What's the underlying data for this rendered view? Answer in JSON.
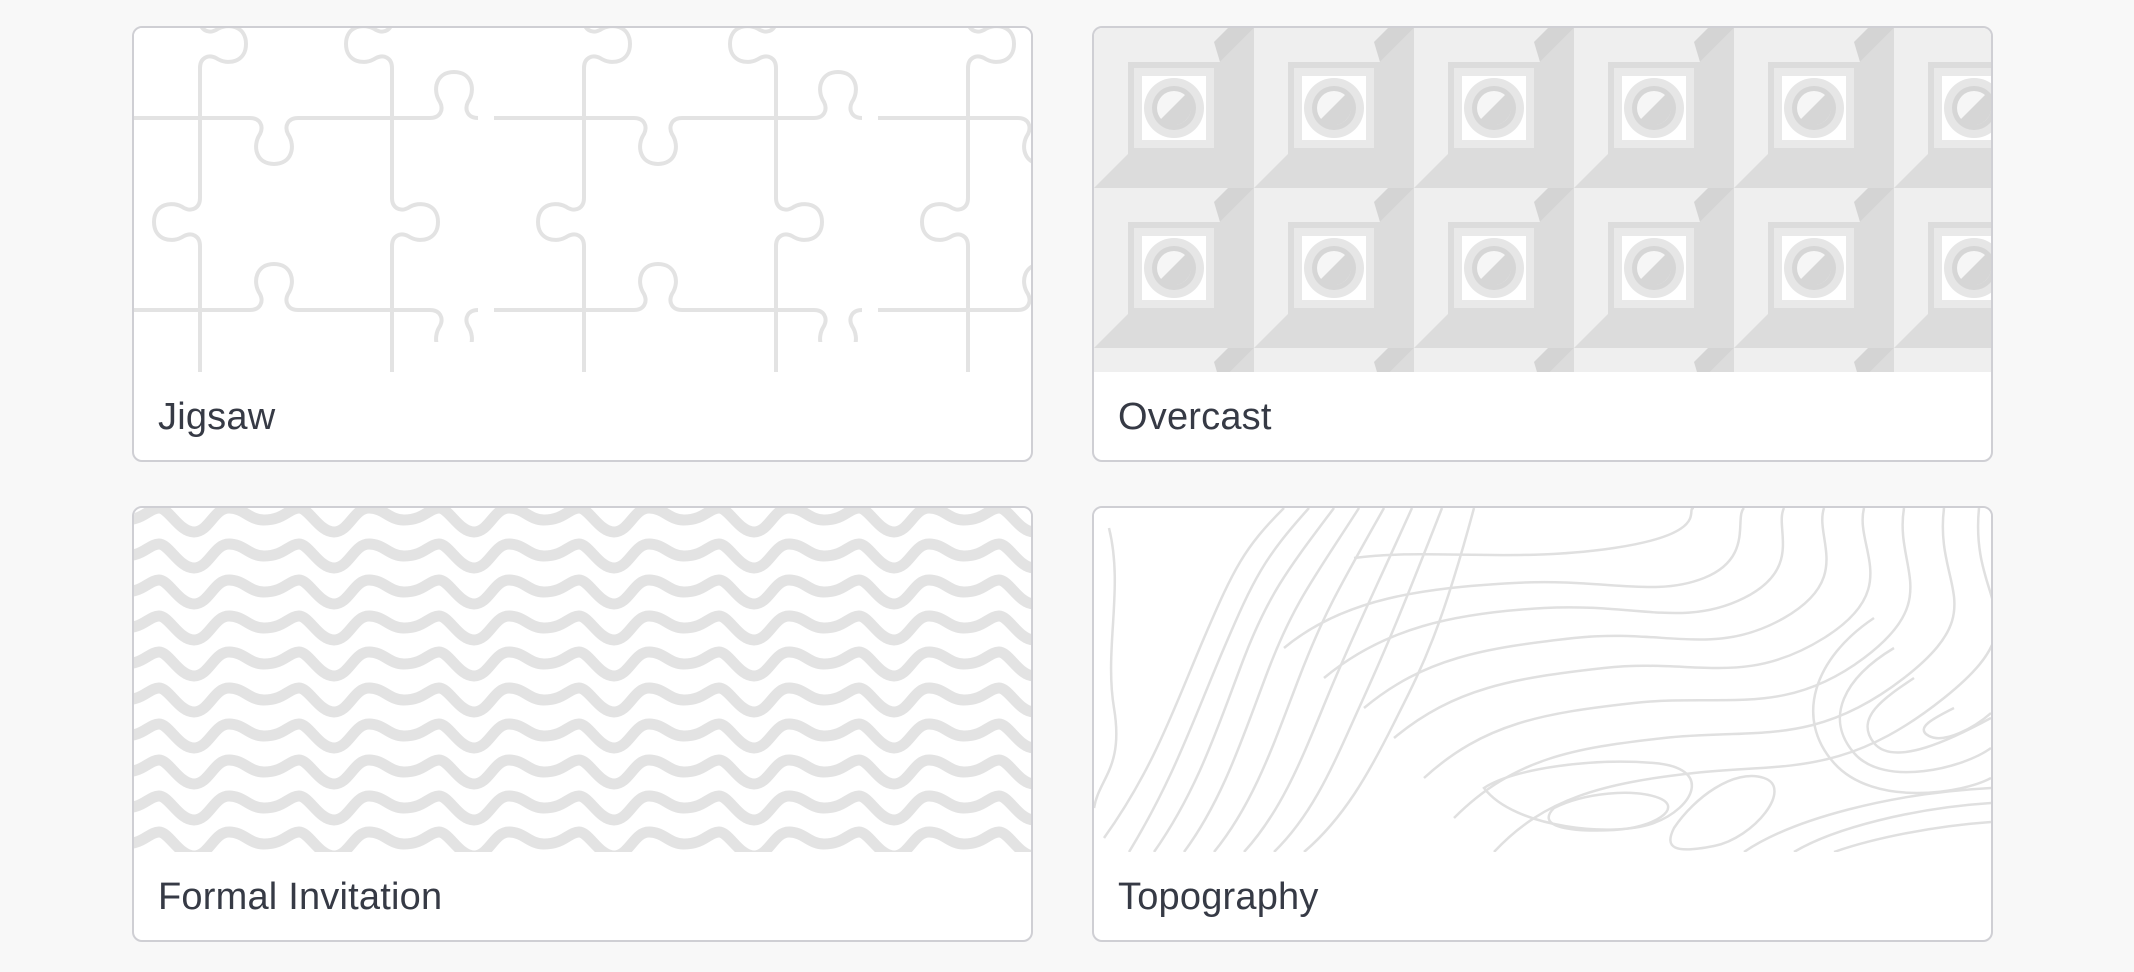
{
  "patterns": [
    {
      "name": "Jigsaw",
      "preview_icon": "jigsaw-pattern"
    },
    {
      "name": "Overcast",
      "preview_icon": "overcast-pattern"
    },
    {
      "name": "Formal Invitation",
      "preview_icon": "wave-pattern"
    },
    {
      "name": "Topography",
      "preview_icon": "topography-pattern"
    }
  ],
  "colors": {
    "page_background": "#f8f8f8",
    "card_background": "#ffffff",
    "card_border": "#cfcfd4",
    "pattern_light": "#efefef",
    "pattern_mid": "#dcdcdc",
    "pattern_line": "#e3e3e3",
    "label_text": "#363a45"
  }
}
